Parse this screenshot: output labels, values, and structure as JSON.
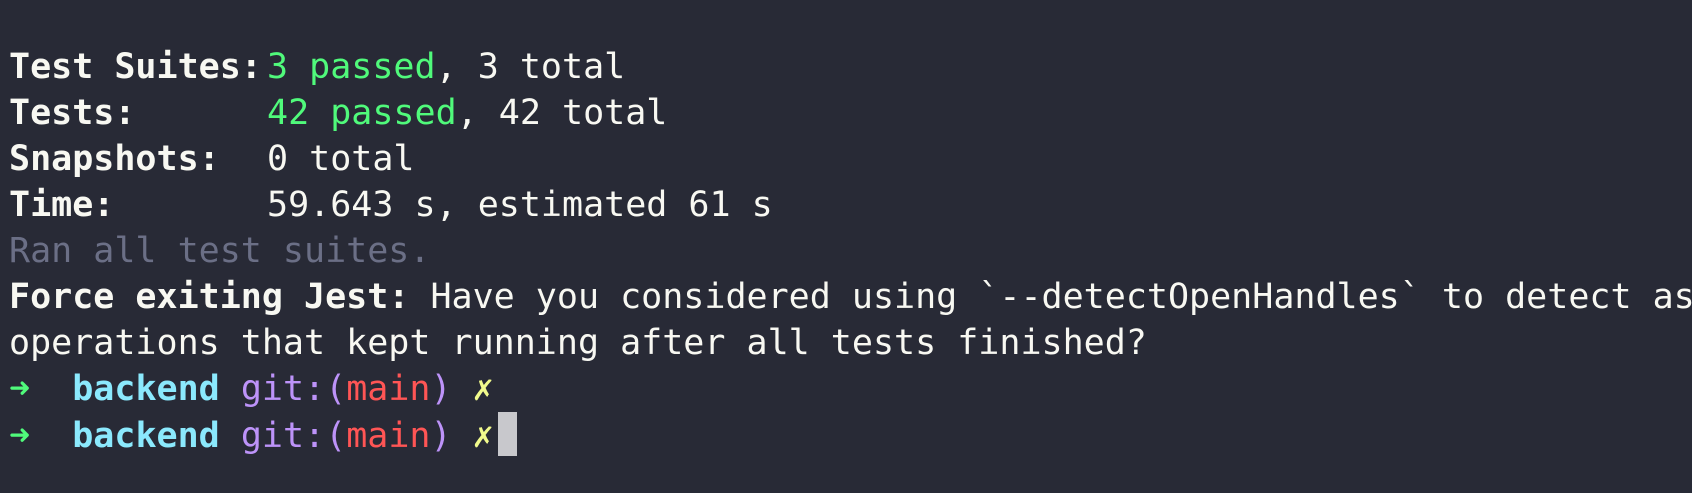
{
  "summary": {
    "suites_label": "Test Suites:",
    "suites_passed": "3 passed",
    "suites_total": ", 3 total",
    "tests_label": "Tests:",
    "tests_passed": "42 passed",
    "tests_total": ", 42 total",
    "snapshots_label": "Snapshots:",
    "snapshots_value": "0 total",
    "time_label": "Time:",
    "time_value": "59.643 s, estimated 61 s",
    "ran_all": "Ran all test suites."
  },
  "force_exit": {
    "label": "Force exiting Jest:",
    "message_line1": " Have you considered using `--detectOpenHandles` to detect async",
    "message_line2": "operations that kept running after all tests finished?"
  },
  "prompts": [
    {
      "arrow": "➜",
      "dir": "backend",
      "git_prefix": "git:(",
      "branch": "main",
      "git_suffix": ")",
      "dirty": "✗"
    },
    {
      "arrow": "➜",
      "dir": "backend",
      "git_prefix": "git:(",
      "branch": "main",
      "git_suffix": ")",
      "dirty": "✗"
    }
  ],
  "colors": {
    "background": "#282a36",
    "passed": "#50fa7b",
    "directory": "#8be9fd",
    "git": "#bd93f9",
    "branch": "#ff5555",
    "dirty_marker": "#f1fa8c"
  }
}
